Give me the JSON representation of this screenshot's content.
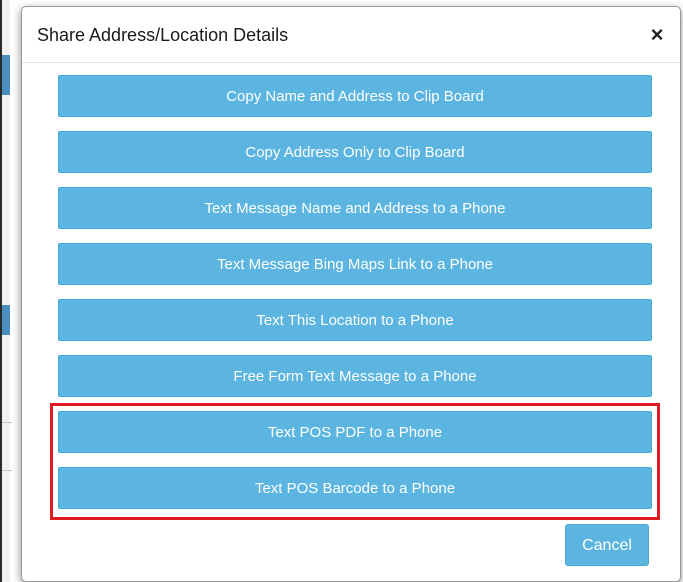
{
  "modal": {
    "title": "Share Address/Location Details",
    "close_label": "×",
    "close_icon": "close-icon"
  },
  "actions": [
    {
      "label": "Copy Name and Address to Clip Board"
    },
    {
      "label": "Copy Address Only to Clip Board"
    },
    {
      "label": "Text Message Name and Address to a Phone"
    },
    {
      "label": "Text Message Bing Maps Link to a Phone"
    },
    {
      "label": "Text This Location to a Phone"
    },
    {
      "label": "Free Form Text Message to a Phone"
    },
    {
      "label": "Text POS PDF to a Phone"
    },
    {
      "label": "Text POS Barcode to a Phone"
    }
  ],
  "footer": {
    "cancel_label": "Cancel"
  },
  "colors": {
    "button": "#5bb5e0",
    "highlight": "#e01b22"
  }
}
